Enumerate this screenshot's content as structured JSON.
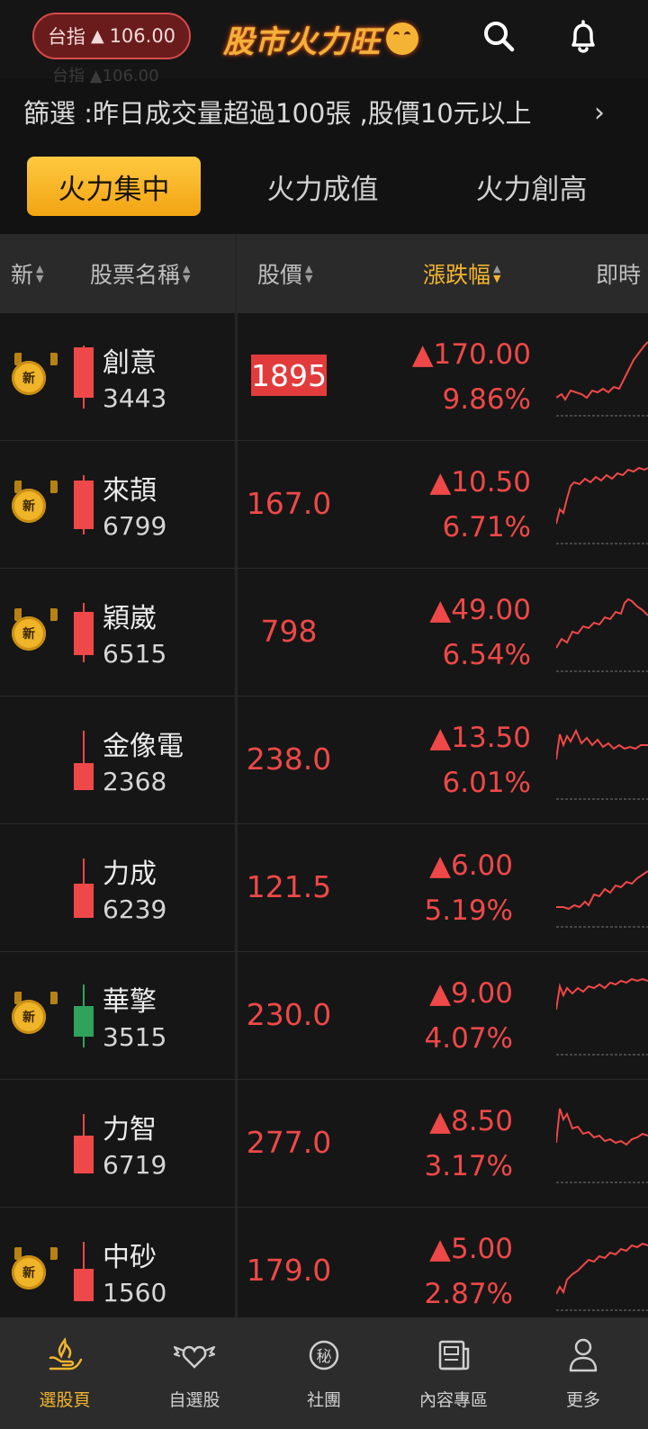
{
  "header": {
    "index_label": "台指",
    "index_value": "106.00",
    "logo_text": "股市火力旺",
    "search_icon": "search-icon",
    "bell_icon": "bell-icon"
  },
  "filter": {
    "text": "篩選 :昨日成交量超過100張 ,股價10元以上",
    "arrow": "›"
  },
  "tabs": [
    {
      "label": "火力集中",
      "active": true
    },
    {
      "label": "火力成值",
      "active": false
    },
    {
      "label": "火力創高",
      "active": false
    }
  ],
  "table_header": {
    "new": "新",
    "name": "股票名稱",
    "price": "股價",
    "change": "漲跌幅",
    "realtime": "即時"
  },
  "colors": {
    "up": "#ef4848",
    "down": "#2fa35c",
    "accent": "#f3b52e"
  },
  "rows": [
    {
      "badge": "新",
      "name": "創意",
      "code": "3443",
      "price": "1895",
      "change": "▲170.00",
      "pct": "9.86%",
      "candle": "up"
    },
    {
      "badge": "新",
      "name": "來頡",
      "code": "6799",
      "price": "167.0",
      "change": "▲10.50",
      "pct": "6.71%",
      "candle": "up"
    },
    {
      "badge": "新",
      "name": "穎崴",
      "code": "6515",
      "price": "798",
      "change": "▲49.00",
      "pct": "6.54%",
      "candle": "up"
    },
    {
      "badge": "",
      "name": "金像電",
      "code": "2368",
      "price": "238.0",
      "change": "▲13.50",
      "pct": "6.01%",
      "candle": "up"
    },
    {
      "badge": "",
      "name": "力成",
      "code": "6239",
      "price": "121.5",
      "change": "▲6.00",
      "pct": "5.19%",
      "candle": "up"
    },
    {
      "badge": "新",
      "name": "華擎",
      "code": "3515",
      "price": "230.0",
      "change": "▲9.00",
      "pct": "4.07%",
      "candle": "down"
    },
    {
      "badge": "",
      "name": "力智",
      "code": "6719",
      "price": "277.0",
      "change": "▲8.50",
      "pct": "3.17%",
      "candle": "up"
    },
    {
      "badge": "新",
      "name": "中砂",
      "code": "1560",
      "price": "179.0",
      "change": "▲5.00",
      "pct": "2.87%",
      "candle": "up"
    }
  ],
  "bottom_nav": [
    {
      "label": "選股頁",
      "icon": "stock-pick-icon",
      "active": true
    },
    {
      "label": "自選股",
      "icon": "winged-heart-icon",
      "active": false
    },
    {
      "label": "社團",
      "icon": "secret-club-icon",
      "active": false
    },
    {
      "label": "內容專區",
      "icon": "news-icon",
      "active": false
    },
    {
      "label": "更多",
      "icon": "person-icon",
      "active": false
    }
  ]
}
